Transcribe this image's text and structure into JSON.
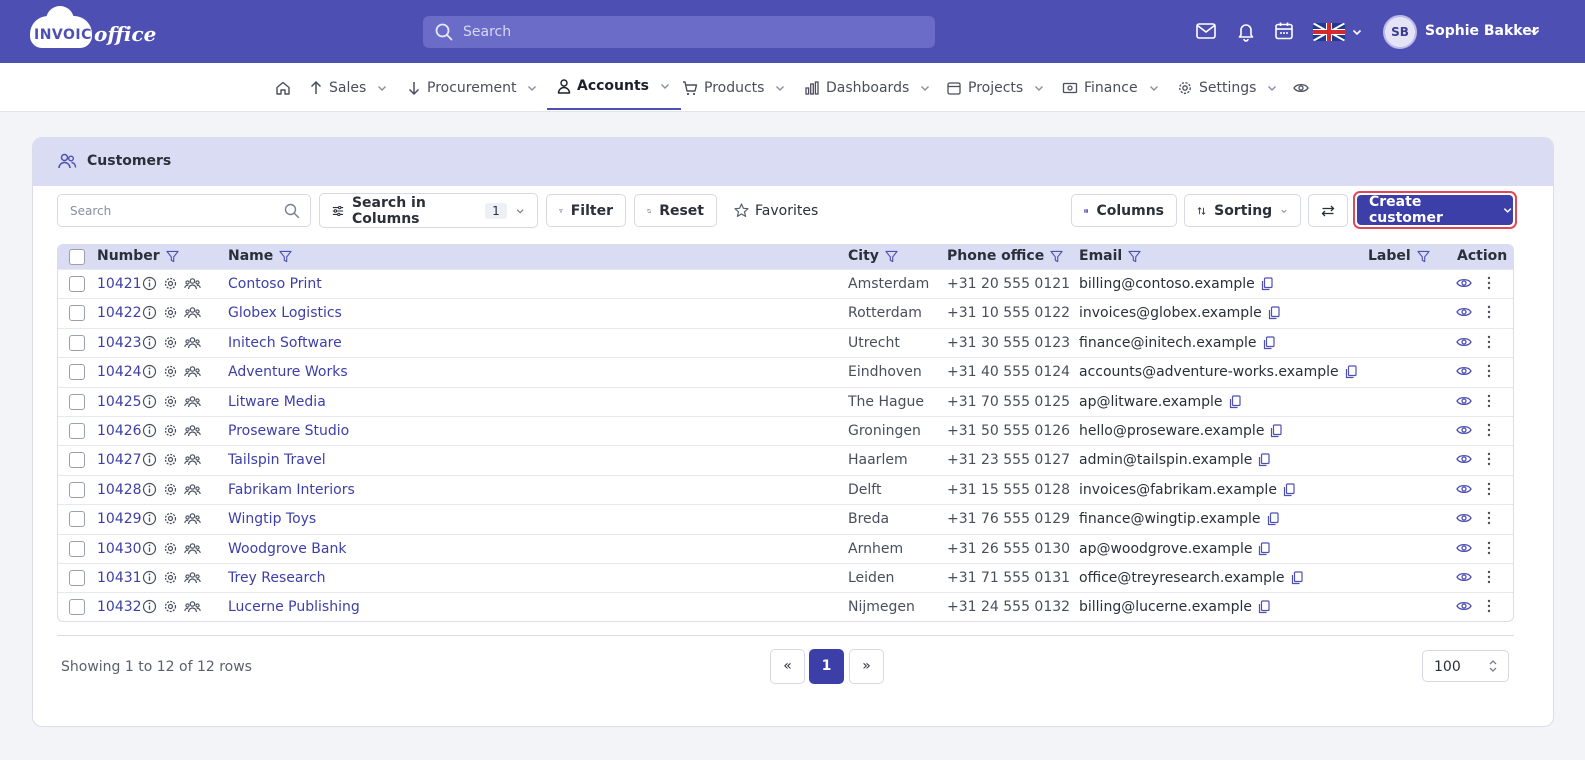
{
  "app": {
    "logo_primary": "INVOICE",
    "logo_secondary": "office",
    "search_placeholder": "Search",
    "user_initials": "SB",
    "user_name": "Sophie Bakker",
    "language": "English (UK flag)"
  },
  "nav": {
    "items": [
      {
        "label": "Sales",
        "icon": "upload-arrow-icon"
      },
      {
        "label": "Procurement",
        "icon": "download-arrow-icon"
      },
      {
        "label": "Accounts",
        "icon": "user-icon",
        "active": true
      },
      {
        "label": "Products",
        "icon": "cart-icon"
      },
      {
        "label": "Dashboards",
        "icon": "bar-chart-icon"
      },
      {
        "label": "Projects",
        "icon": "calendar-icon"
      },
      {
        "label": "Finance",
        "icon": "money-icon"
      },
      {
        "label": "Settings",
        "icon": "gear-icon"
      }
    ]
  },
  "card": {
    "title": "Customers"
  },
  "toolbar": {
    "search_placeholder": "Search",
    "search_in_columns": "Search in Columns",
    "search_in_columns_count": "1",
    "filter": "Filter",
    "reset": "Reset",
    "favorites": "Favorites",
    "columns": "Columns",
    "sorting": "Sorting",
    "create_customer": "Create customer"
  },
  "table": {
    "headers": {
      "number": "Number",
      "name": "Name",
      "city": "City",
      "phone": "Phone office",
      "email": "Email",
      "label": "Label",
      "action": "Action"
    },
    "rows": [
      {
        "number": "10421",
        "name": "Contoso Print",
        "city": "Amsterdam",
        "phone": "+31 20 555 0121",
        "email": "billing@contoso.example"
      },
      {
        "number": "10422",
        "name": "Globex Logistics",
        "city": "Rotterdam",
        "phone": "+31 10 555 0122",
        "email": "invoices@globex.example"
      },
      {
        "number": "10423",
        "name": "Initech Software",
        "city": "Utrecht",
        "phone": "+31 30 555 0123",
        "email": "finance@initech.example"
      },
      {
        "number": "10424",
        "name": "Adventure Works",
        "city": "Eindhoven",
        "phone": "+31 40 555 0124",
        "email": "accounts@adventure-works.example"
      },
      {
        "number": "10425",
        "name": "Litware Media",
        "city": "The Hague",
        "phone": "+31 70 555 0125",
        "email": "ap@litware.example"
      },
      {
        "number": "10426",
        "name": "Proseware Studio",
        "city": "Groningen",
        "phone": "+31 50 555 0126",
        "email": "hello@proseware.example"
      },
      {
        "number": "10427",
        "name": "Tailspin Travel",
        "city": "Haarlem",
        "phone": "+31 23 555 0127",
        "email": "admin@tailspin.example"
      },
      {
        "number": "10428",
        "name": "Fabrikam Interiors",
        "city": "Delft",
        "phone": "+31 15 555 0128",
        "email": "invoices@fabrikam.example"
      },
      {
        "number": "10429",
        "name": "Wingtip Toys",
        "city": "Breda",
        "phone": "+31 76 555 0129",
        "email": "finance@wingtip.example"
      },
      {
        "number": "10430",
        "name": "Woodgrove Bank",
        "city": "Arnhem",
        "phone": "+31 26 555 0130",
        "email": "ap@woodgrove.example"
      },
      {
        "number": "10431",
        "name": "Trey Research",
        "city": "Leiden",
        "phone": "+31 71 555 0131",
        "email": "office@treyresearch.example"
      },
      {
        "number": "10432",
        "name": "Lucerne Publishing",
        "city": "Nijmegen",
        "phone": "+31 24 555 0132",
        "email": "billing@lucerne.example"
      }
    ]
  },
  "footer": {
    "showing": "Showing 1 to 12 of 12 rows",
    "prev": "«",
    "page": "1",
    "next": "»",
    "page_size": "100"
  },
  "colors": {
    "brand": "#4e4fb3",
    "primary_button": "#3d3fa8",
    "highlight_outline": "#e0485a",
    "header_band": "#dadcf3"
  }
}
